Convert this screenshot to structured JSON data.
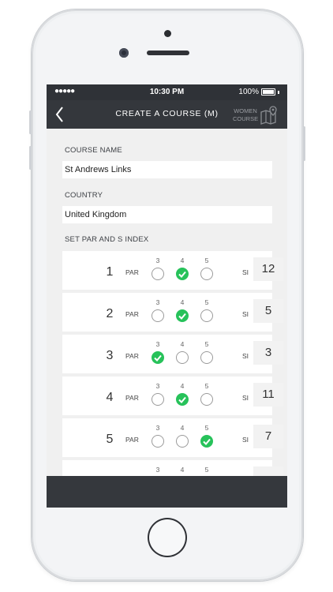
{
  "status_bar": {
    "signal": "●●●●●",
    "time": "10:30 PM",
    "battery": "100%"
  },
  "nav": {
    "title": "CREATE A COURSE (M)",
    "women_course": "WOMEN COURSE"
  },
  "form": {
    "course_name_label": "COURSE NAME",
    "course_name_value": "St Andrews Links",
    "country_label": "COUNTRY",
    "country_value": "United Kingdom",
    "par_section_label": "SET PAR AND S INDEX"
  },
  "par_label": "PAR",
  "si_label": "SI",
  "par_options": [
    "3",
    "4",
    "5"
  ],
  "holes": [
    {
      "number": "1",
      "par": "4",
      "si": "12"
    },
    {
      "number": "2",
      "par": "4",
      "si": "5"
    },
    {
      "number": "3",
      "par": "3",
      "si": "3"
    },
    {
      "number": "4",
      "par": "4",
      "si": "11"
    },
    {
      "number": "5",
      "par": "5",
      "si": "7"
    },
    {
      "number": "",
      "par": "",
      "si": ""
    }
  ],
  "colors": {
    "accent": "#27c25a",
    "bar": "#34373c"
  }
}
